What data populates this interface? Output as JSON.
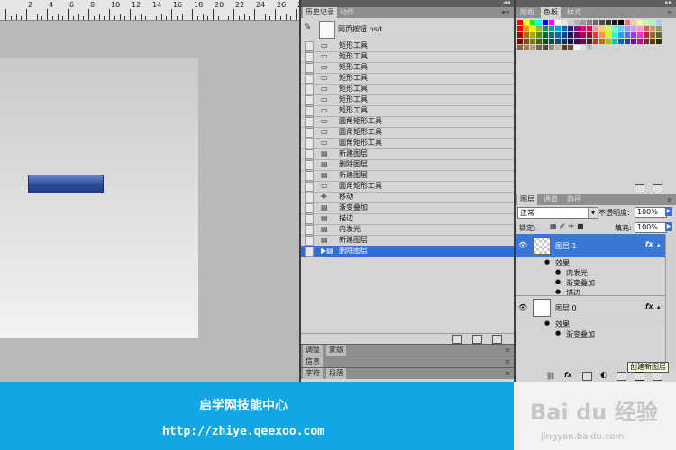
{
  "ruler": {
    "labels": [
      "2",
      "4",
      "6",
      "8",
      "10",
      "12",
      "14",
      "16",
      "18",
      "20",
      "22",
      "24",
      "26",
      "28"
    ]
  },
  "history": {
    "tabs": [
      "历史记录",
      "动作"
    ],
    "snapshot": "网页按钮.psd",
    "items": [
      {
        "label": "矩形工具",
        "icon": "rect"
      },
      {
        "label": "矩形工具",
        "icon": "rect"
      },
      {
        "label": "矩形工具",
        "icon": "rect"
      },
      {
        "label": "矩形工具",
        "icon": "rect"
      },
      {
        "label": "矩形工具",
        "icon": "rect"
      },
      {
        "label": "矩形工具",
        "icon": "rect"
      },
      {
        "label": "矩形工具",
        "icon": "rect"
      },
      {
        "label": "圆角矩形工具",
        "icon": "rect"
      },
      {
        "label": "圆角矩形工具",
        "icon": "rect"
      },
      {
        "label": "圆角矩形工具",
        "icon": "rect"
      },
      {
        "label": "新建图层",
        "icon": "doc"
      },
      {
        "label": "删除图层",
        "icon": "doc"
      },
      {
        "label": "新建图层",
        "icon": "doc"
      },
      {
        "label": "圆角矩形工具",
        "icon": "rect"
      },
      {
        "label": "移动",
        "icon": "move"
      },
      {
        "label": "渐变叠加",
        "icon": "doc"
      },
      {
        "label": "描边",
        "icon": "doc"
      },
      {
        "label": "内发光",
        "icon": "doc"
      },
      {
        "label": "新建图层",
        "icon": "doc"
      },
      {
        "label": "删除图层",
        "icon": "doc",
        "selected": true
      }
    ]
  },
  "collapsed_panels": [
    {
      "tabs": [
        "调整",
        "蒙版"
      ]
    },
    {
      "tabs": [
        "信息"
      ]
    },
    {
      "tabs": [
        "字符",
        "段落"
      ]
    }
  ],
  "swatches": {
    "tabs": [
      "颜色",
      "色板",
      "样式"
    ],
    "active_tab": "色板",
    "colors": [
      "#ff0000",
      "#ffff00",
      "#00ff00",
      "#00ffff",
      "#0000ff",
      "#ff00ff",
      "#ffffff",
      "#e6e6e6",
      "#cccccc",
      "#b3b3b3",
      "#999999",
      "#808080",
      "#666666",
      "#4d4d4d",
      "#333333",
      "#1a1a1a",
      "#000000",
      "#ff6666",
      "#ffcc99",
      "#ffff99",
      "#ccff99",
      "#99ffcc",
      "#99ccff",
      "#e60012",
      "#f39800",
      "#fff100",
      "#8fc31f",
      "#009944",
      "#009e96",
      "#00a0e9",
      "#0068b7",
      "#1d2088",
      "#920783",
      "#e4007f",
      "#e5004f",
      "#ff9999",
      "#ffcc66",
      "#ccff66",
      "#66ffcc",
      "#66ccff",
      "#9999ff",
      "#cc99ff",
      "#ff99cc",
      "#cc6666",
      "#cc9966",
      "#999966",
      "#a40000",
      "#b36b00",
      "#b3a900",
      "#5f8a00",
      "#006b2f",
      "#00706a",
      "#0070a3",
      "#004b84",
      "#111365",
      "#66005f",
      "#a5005a",
      "#a50037",
      "#ff3333",
      "#ff9933",
      "#ccff33",
      "#33ffcc",
      "#3399ff",
      "#6666ff",
      "#9933ff",
      "#ff33cc",
      "#993333",
      "#996633",
      "#666633",
      "#7d0000",
      "#7f4c00",
      "#7f7800",
      "#436200",
      "#004b21",
      "#004f4b",
      "#004f74",
      "#00355e",
      "#0b0d48",
      "#480043",
      "#750040",
      "#750027",
      "#cc3300",
      "#cc6600",
      "#99cc00",
      "#00cc99",
      "#0066cc",
      "#3333cc",
      "#6600cc",
      "#cc0099",
      "#663333",
      "#663300",
      "#333300",
      "#8c6239",
      "#a67c52",
      "#c69c6d",
      "#736357",
      "#534741",
      "#998675",
      "#c7b299",
      "#603813",
      "#754c24",
      "#ffffff",
      "#e0e0e0",
      "#c0c0c0"
    ]
  },
  "layers": {
    "tabs": [
      "图层",
      "通道",
      "路径"
    ],
    "blend_mode": "正常",
    "opacity_label": "不透明度:",
    "opacity": "100%",
    "lock_label": "锁定:",
    "fill_label": "填充:",
    "fill": "100%",
    "fx_symbol": "fx",
    "list": [
      {
        "name": "图层 1",
        "selected": true,
        "effects_label": "效果",
        "effects": [
          "内发光",
          "渐变叠加",
          "描边"
        ]
      },
      {
        "name": "图层 0",
        "selected": false,
        "effects_label": "效果",
        "effects": [
          "渐变叠加"
        ]
      }
    ],
    "tooltip": "创建新图层"
  },
  "banner": {
    "title": "启学网技能中心",
    "url": "http://zhiye.qeexoo.com"
  },
  "watermark": {
    "logo": "Bai du 经验",
    "url": "jingyan.baidu.com"
  }
}
